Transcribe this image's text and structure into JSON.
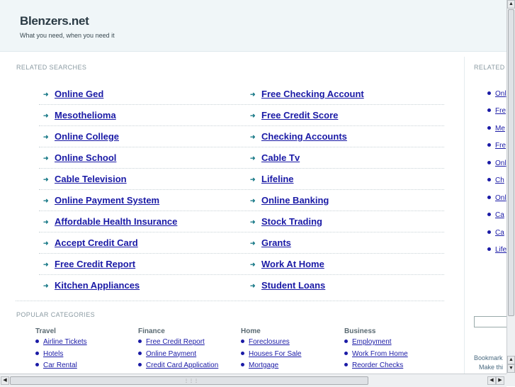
{
  "header": {
    "title": "Blenzers.net",
    "tagline": "What you need, when you need it"
  },
  "related_searches": {
    "heading": "RELATED SEARCHES",
    "left": [
      "Online Ged",
      "Mesothelioma",
      "Online College",
      "Online School",
      "Cable Television",
      "Online Payment System",
      "Affordable Health Insurance",
      "Accept Credit Card",
      "Free Credit Report",
      "Kitchen Appliances"
    ],
    "right": [
      "Free Checking Account",
      "Free Credit Score",
      "Checking Accounts",
      "Cable Tv",
      "Lifeline",
      "Online Banking",
      "Stock Trading",
      "Grants",
      "Work At Home",
      "Student Loans"
    ]
  },
  "popular_categories": {
    "heading": "POPULAR CATEGORIES",
    "columns": [
      {
        "title": "Travel",
        "items": [
          "Airline Tickets",
          "Hotels",
          "Car Rental"
        ]
      },
      {
        "title": "Finance",
        "items": [
          "Free Credit Report",
          "Online Payment",
          "Credit Card Application"
        ]
      },
      {
        "title": "Home",
        "items": [
          "Foreclosures",
          "Houses For Sale",
          "Mortgage"
        ]
      },
      {
        "title": "Business",
        "items": [
          "Employment",
          "Work From Home",
          "Reorder Checks"
        ]
      }
    ]
  },
  "right_panel": {
    "heading": "RELATED",
    "items": [
      "Onl",
      "Fre",
      "Me",
      "Fre",
      "Onl",
      "Ch",
      "Onl",
      "Ca",
      "Ca",
      "Life"
    ],
    "bookmark": "Bookmark",
    "make": "Make thi"
  },
  "colors": {
    "link": "#1a1aa6",
    "arrow": "#1e7c8a",
    "header_bg": "#f0f6f8"
  }
}
